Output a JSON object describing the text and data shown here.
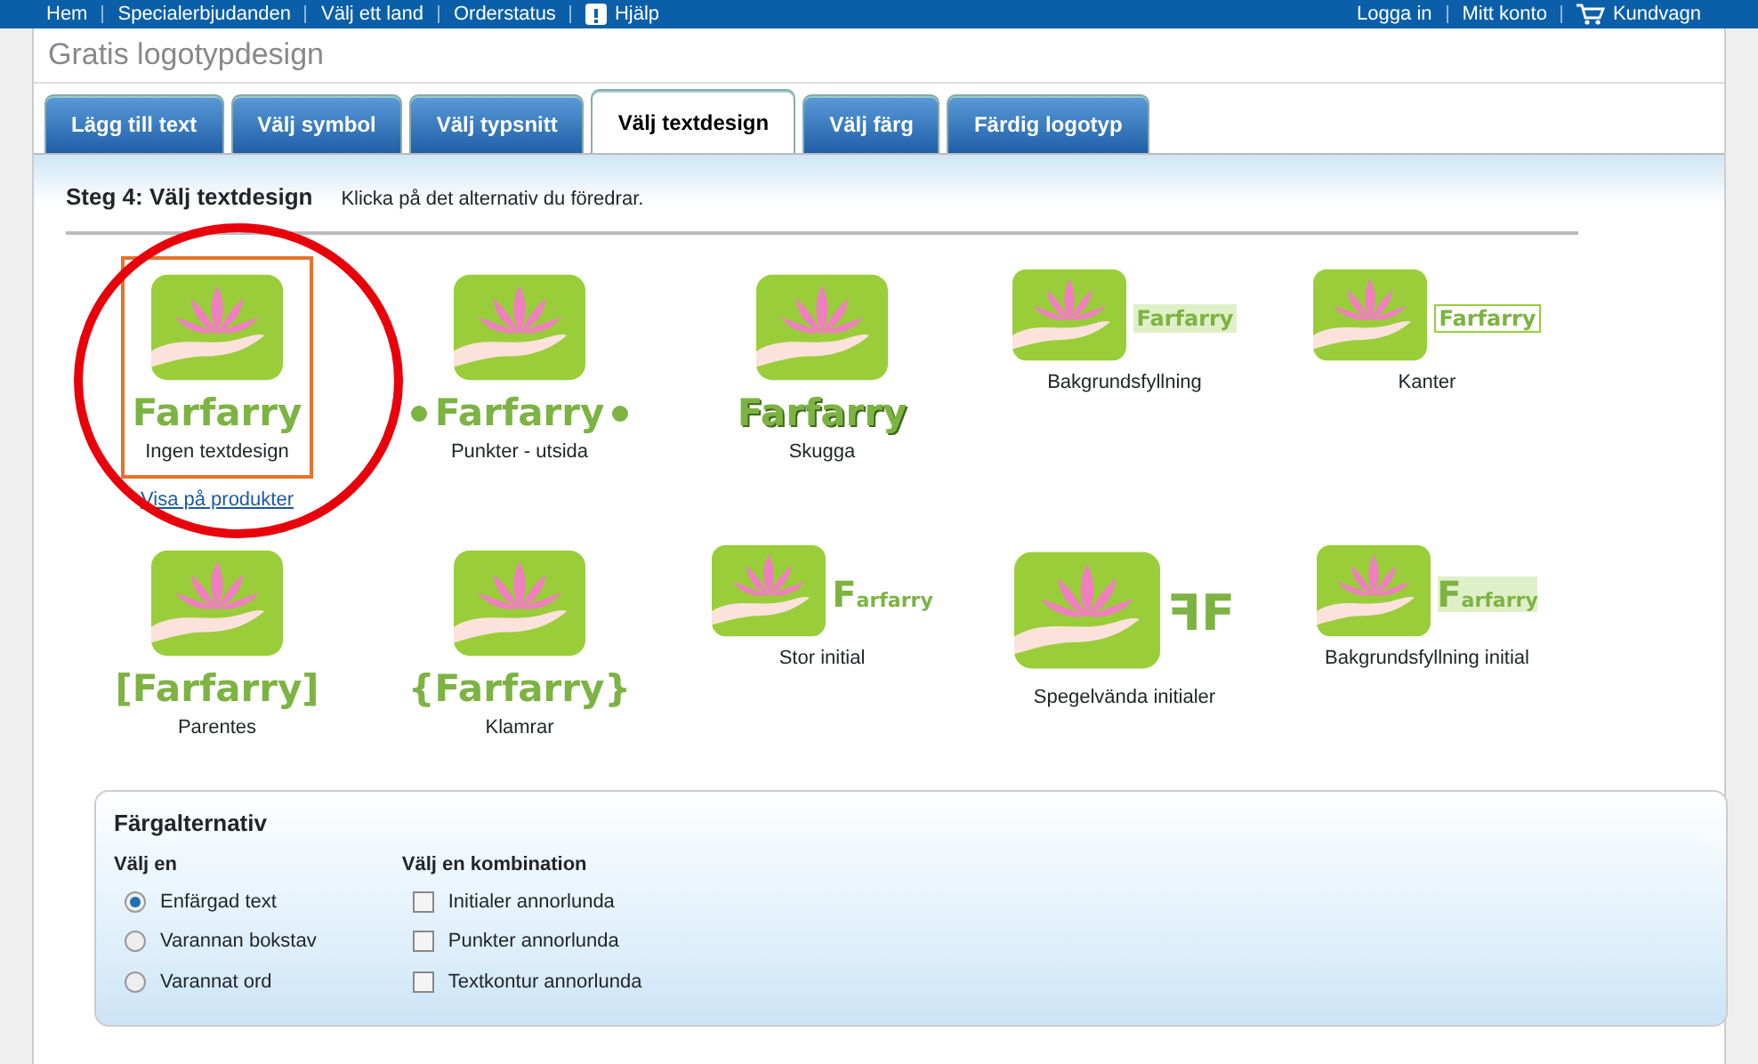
{
  "top_nav": {
    "left": [
      {
        "label": "Hem",
        "kind": "link"
      },
      {
        "label": "Specialerbjudanden",
        "kind": "link"
      },
      {
        "label": "Välj ett land",
        "kind": "link"
      },
      {
        "label": "Orderstatus",
        "kind": "link"
      },
      {
        "label": "Hjälp",
        "kind": "help"
      }
    ],
    "right": [
      {
        "label": "Logga in",
        "kind": "link"
      },
      {
        "label": "Mitt konto",
        "kind": "link"
      },
      {
        "label": "Kundvagn",
        "kind": "cart"
      }
    ]
  },
  "page_title": "Gratis logotypdesign",
  "tabs": [
    {
      "label": "Lägg till text",
      "selected": false
    },
    {
      "label": "Välj symbol",
      "selected": false
    },
    {
      "label": "Välj typsnitt",
      "selected": false
    },
    {
      "label": "Välj textdesign",
      "selected": true
    },
    {
      "label": "Välj färg",
      "selected": false
    },
    {
      "label": "Färdig logotyp",
      "selected": false
    }
  ],
  "step": {
    "title": "Steg 4: Välj textdesign",
    "hint": "Klicka på det alternativ du föredrar."
  },
  "designs": [
    {
      "kind": "plain",
      "logo_text": "Farfarry",
      "label": "Ingen textdesign",
      "selected": true,
      "link": "Visa på produkter"
    },
    {
      "kind": "dots",
      "logo_text": "Farfarry",
      "label": "Punkter - utsida",
      "selected": false
    },
    {
      "kind": "shadow",
      "logo_text": "Farfarry",
      "label": "Skugga",
      "selected": false
    },
    {
      "kind": "fill",
      "logo_text": "Farfarry",
      "label": "Bakgrundsfyllning",
      "selected": false
    },
    {
      "kind": "border",
      "logo_text": "Farfarry",
      "label": "Kanter",
      "selected": false
    },
    {
      "kind": "brackets",
      "logo_text": "[Farfarry]",
      "label": "Parentes",
      "selected": false
    },
    {
      "kind": "braces",
      "logo_text": "{Farfarry}",
      "label": "Klamrar",
      "selected": false
    },
    {
      "kind": "initial",
      "logo_text": "Farfarry",
      "label": "Stor initial",
      "selected": false
    },
    {
      "kind": "mirror",
      "logo_text": "ꟻF",
      "label": "Spegelvända initialer",
      "selected": false
    },
    {
      "kind": "fill_initial",
      "logo_text": "Farfarry",
      "label": "Bakgrundsfyllning initial",
      "selected": false
    }
  ],
  "color_options": {
    "title": "Färgalternativ",
    "single": {
      "heading": "Välj en",
      "options": [
        {
          "label": "Enfärgad text",
          "selected": true
        },
        {
          "label": "Varannan bokstav",
          "selected": false
        },
        {
          "label": "Varannat ord",
          "selected": false
        }
      ]
    },
    "combo": {
      "heading": "Välj en kombination",
      "options": [
        {
          "label": "Initialer annorlunda",
          "checked": false
        },
        {
          "label": "Punkter annorlunda",
          "checked": false
        },
        {
          "label": "Textkontur annorlunda",
          "checked": false
        }
      ]
    }
  }
}
